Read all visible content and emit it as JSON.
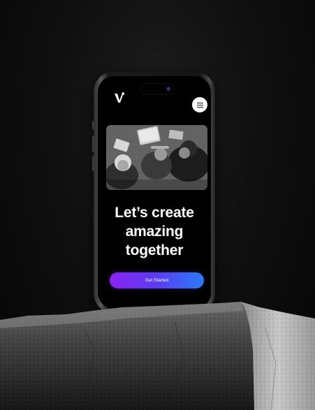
{
  "page": {
    "headline_lines": [
      "Let’s create",
      "amazing",
      "together"
    ],
    "cta_label": "Get Started"
  },
  "header": {
    "logo_icon": "brand-logo-icon",
    "menu_icon": "hamburger-menu-icon"
  },
  "colors": {
    "cta_gradient_start": "#8a22ef",
    "cta_gradient_end": "#2a7bf6",
    "screen_background": "#000000",
    "text": "#ffffff"
  }
}
